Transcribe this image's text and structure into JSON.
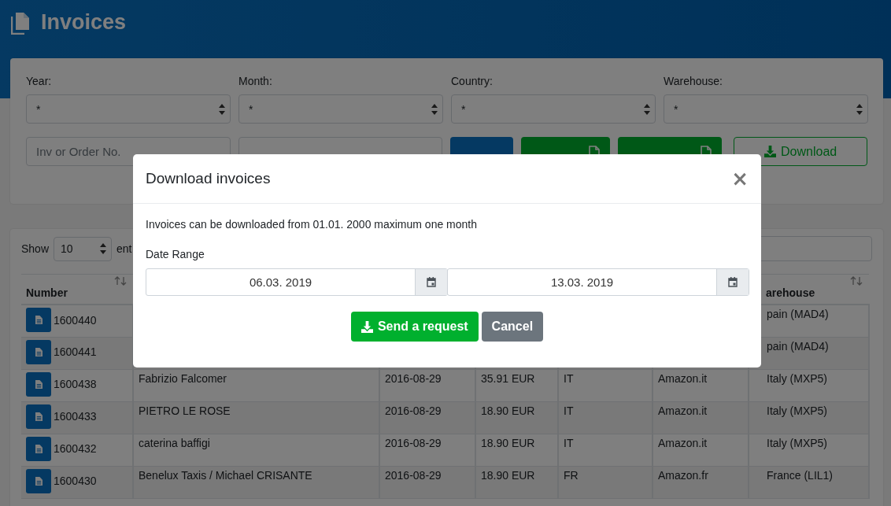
{
  "page": {
    "title": "Invoices"
  },
  "filters": {
    "selects": [
      {
        "label": "Year:",
        "value": "*"
      },
      {
        "label": "Month:",
        "value": "*"
      },
      {
        "label": "Country:",
        "value": "*"
      },
      {
        "label": "Warehouse:",
        "value": "*"
      }
    ],
    "fields": [
      {
        "placeholder": "Inv or Order No."
      }
    ],
    "buttons": [
      {
        "kind": "primary"
      },
      {
        "kind": "export"
      },
      {
        "kind": "export"
      },
      {
        "label": "Download",
        "kind": "outline"
      }
    ]
  },
  "table": {
    "show_label": "Show",
    "page_size": "10",
    "entries_label": "ent",
    "columns": [
      {
        "label": "Number",
        "sortable": true
      },
      {},
      {},
      {},
      {},
      {},
      {
        "label": "arehouse",
        "sortable": true
      }
    ],
    "rows": [
      {
        "cells": [
          "1600440",
          null,
          null,
          null,
          null,
          null,
          "pain (MAD4)"
        ]
      },
      {
        "cells": [
          "1600441",
          null,
          null,
          null,
          null,
          null,
          "pain (MAD4)"
        ]
      },
      {
        "cells": [
          "1600438",
          "Fabrizio Falcomer",
          "2016-08-29",
          "35.91 EUR",
          "IT",
          "Amazon.it",
          "Italy (MXP5)"
        ]
      },
      {
        "cells": [
          "1600433",
          "PIETRO LE ROSE",
          "2016-08-29",
          "18.90 EUR",
          "IT",
          "Amazon.it",
          "Italy (MXP5)"
        ]
      },
      {
        "cells": [
          "1600432",
          "caterina baffigi",
          "2016-08-29",
          "18.90 EUR",
          "IT",
          "Amazon.it",
          "Italy (MXP5)"
        ]
      },
      {
        "cells": [
          "1600430",
          "Benelux Taxis / Michael CRISANTE",
          "2016-08-29",
          "18.90 EUR",
          "FR",
          "Amazon.fr",
          "France (LIL1)"
        ]
      }
    ]
  },
  "modal": {
    "title": "Download invoices",
    "close": "×",
    "message": "Invoices can be downloaded from 01.01. 2000 maximum one month",
    "range_label": "Date Range",
    "from": "06.03. 2019",
    "to": "13.03. 2019",
    "buttons": [
      {
        "label": "Send a request",
        "kind": "success"
      },
      {
        "label": "Cancel",
        "kind": "secondary"
      }
    ]
  }
}
